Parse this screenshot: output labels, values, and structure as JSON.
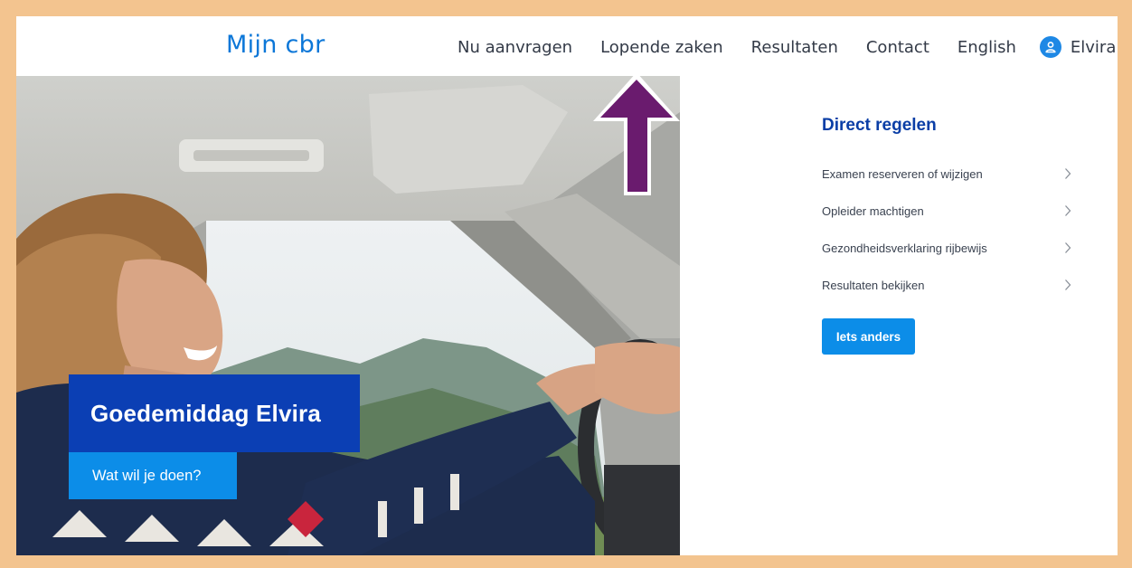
{
  "header": {
    "brand": "Mijn cbr",
    "nav": [
      "Nu aanvragen",
      "Lopende zaken",
      "Resultaten",
      "Contact",
      "English"
    ],
    "user_name": "Elvira"
  },
  "hero": {
    "greeting": "Goedemiddag Elvira",
    "cta": "Wat wil je doen?"
  },
  "panel": {
    "title": "Direct regelen",
    "items": [
      "Examen reserveren of wijzigen",
      "Opleider machtigen",
      "Gezondheidsverklaring rijbewijs",
      "Resultaten bekijken"
    ],
    "button": "Iets anders"
  },
  "icons": {
    "user": "user-icon",
    "chevron": "chevron-right-icon",
    "arrow": "up-arrow-annotation-icon"
  },
  "colors": {
    "brand_blue": "#0c77d8",
    "dark_blue": "#0b3fb4",
    "button_blue": "#0c8de8",
    "border": "#f3c48f",
    "arrow": "#6a1b6e"
  }
}
